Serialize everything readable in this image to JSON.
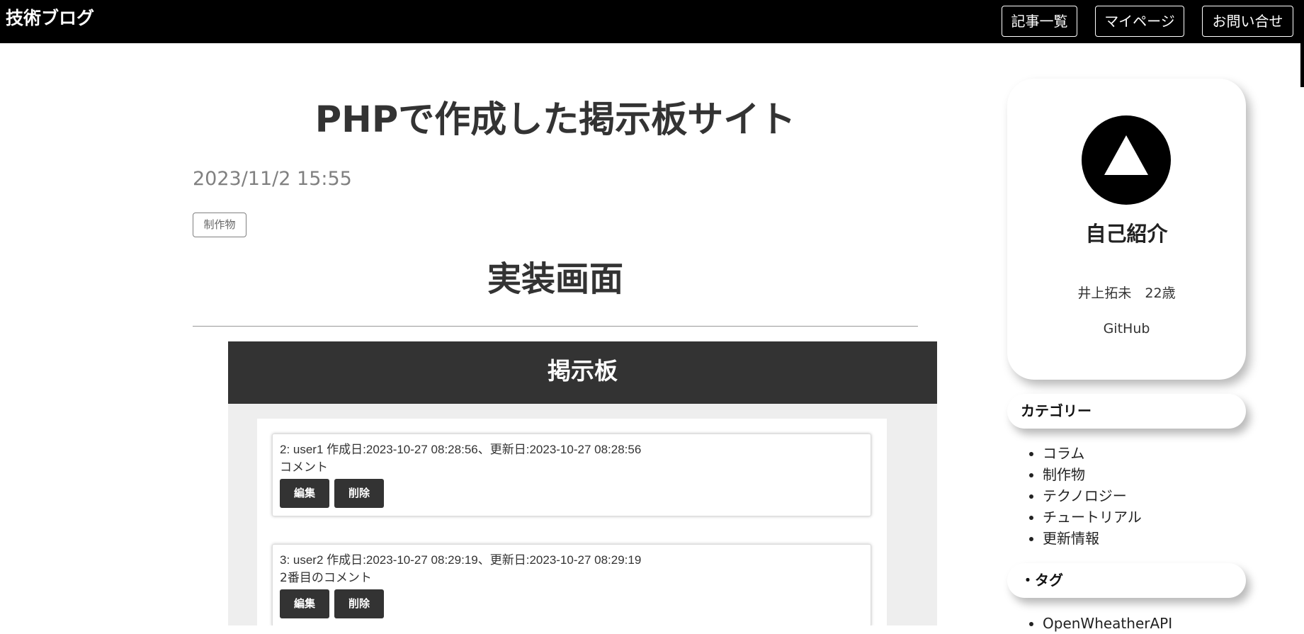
{
  "header": {
    "logo": "技術ブログ",
    "nav": [
      "記事一覧",
      "マイページ",
      "お問い合せ"
    ]
  },
  "article": {
    "title": "PHPで作成した掲示板サイト",
    "date": "2023/11/2 15:55",
    "tag": "制作物",
    "section_heading": "実装画面"
  },
  "screenshot": {
    "title": "掲示板",
    "posts": [
      {
        "meta": "2: user1 作成日:2023-10-27 08:28:56、更新日:2023-10-27 08:28:56",
        "comment": "コメント",
        "edit_label": "編集",
        "delete_label": "削除"
      },
      {
        "meta": "3: user2 作成日:2023-10-27 08:29:19、更新日:2023-10-27 08:29:19",
        "comment": "2番目のコメント",
        "edit_label": "編集",
        "delete_label": "削除"
      }
    ]
  },
  "sidebar": {
    "profile": {
      "avatar_icon": "triangle-icon",
      "title": "自己紹介",
      "name": "井上拓未　22歳",
      "github": "GitHub"
    },
    "categories": {
      "heading": "カテゴリー",
      "items": [
        "コラム",
        "制作物",
        "テクノロジー",
        "チュートリアル",
        "更新情報"
      ]
    },
    "tags": {
      "heading": "・タグ",
      "items": [
        "OpenWheatherAPI"
      ]
    }
  },
  "colors": {
    "header_bg": "#000000",
    "board_bar": "#333333",
    "button_bg": "#333333",
    "date_text": "#808080"
  }
}
